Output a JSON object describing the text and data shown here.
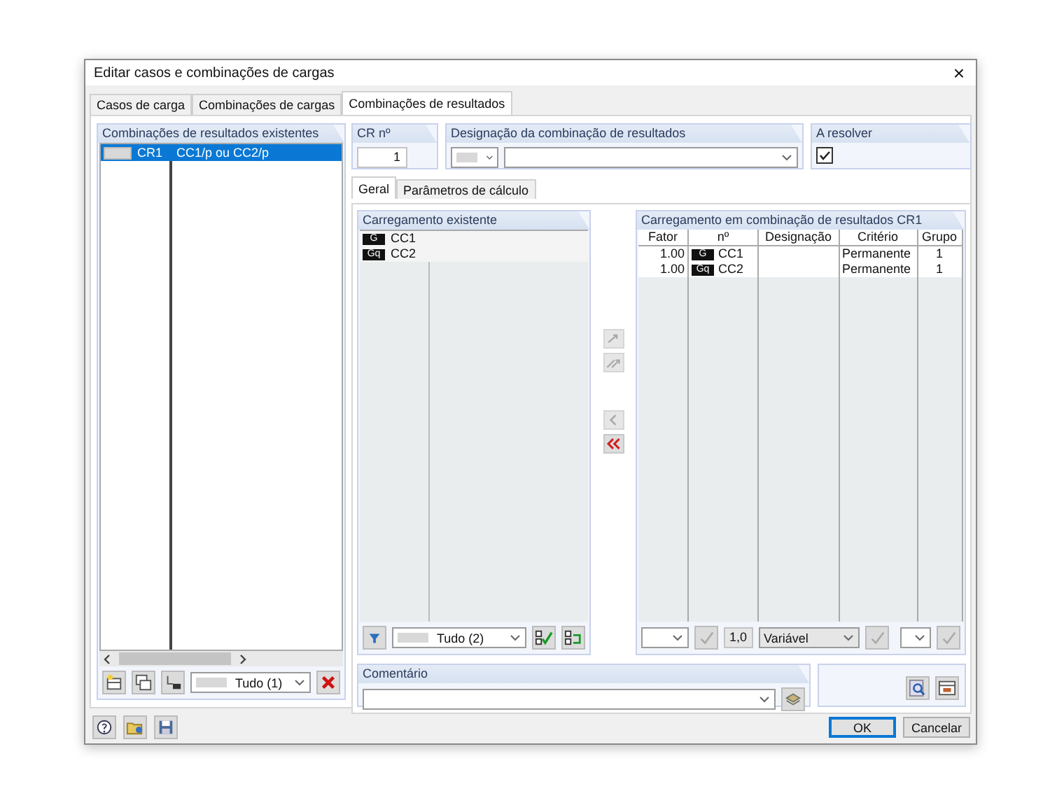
{
  "window": {
    "title": "Editar casos e combinações de cargas",
    "close": "×"
  },
  "tabs": [
    {
      "label": "Casos de carga",
      "selected": false
    },
    {
      "label": "Combinações de cargas",
      "selected": false
    },
    {
      "label": "Combinações de resultados",
      "selected": true
    }
  ],
  "existing_combinations": {
    "header": "Combinações de resultados existentes",
    "rows": [
      {
        "id": "CR1",
        "description": "CC1/p ou CC2/p",
        "selected": true
      }
    ],
    "filter": "Tudo (1)"
  },
  "cr_number": {
    "label": "CR nº",
    "value": "1"
  },
  "designation": {
    "label": "Designação da combinação de resultados"
  },
  "to_solve": {
    "label": "A resolver",
    "checked": true
  },
  "inner_tabs": [
    {
      "label": "Geral",
      "selected": true
    },
    {
      "label": "Parâmetros de cálculo",
      "selected": false
    }
  ],
  "existing_loading": {
    "header": "Carregamento existente",
    "rows": [
      {
        "badge": "G",
        "name": "CC1"
      },
      {
        "badge": "Gq",
        "name": "CC2"
      }
    ],
    "filter": "Tudo (2)"
  },
  "transfer_buttons": [
    {
      "kind": "add",
      "disabled": true
    },
    {
      "kind": "add_all",
      "disabled": true
    },
    {
      "kind": "remove",
      "disabled": true
    },
    {
      "kind": "remove_all",
      "disabled": false
    }
  ],
  "result_loading": {
    "header": "Carregamento em combinação de resultados CR1",
    "columns": [
      "Fator",
      "nº",
      "Designação",
      "Critério",
      "Grupo"
    ],
    "rows": [
      {
        "factor": "1.00",
        "badge": "G",
        "name": "CC1",
        "criterion": "Permanente",
        "group": "1"
      },
      {
        "factor": "1.00",
        "badge": "Gq",
        "name": "CC2",
        "criterion": "Permanente",
        "group": "1"
      }
    ],
    "factor_value": "1,0",
    "criterion_select": "Variável"
  },
  "comment": {
    "label": "Comentário"
  },
  "buttons": [
    {
      "label": "OK",
      "default": true
    },
    {
      "label": "Cancelar",
      "default": false
    }
  ]
}
